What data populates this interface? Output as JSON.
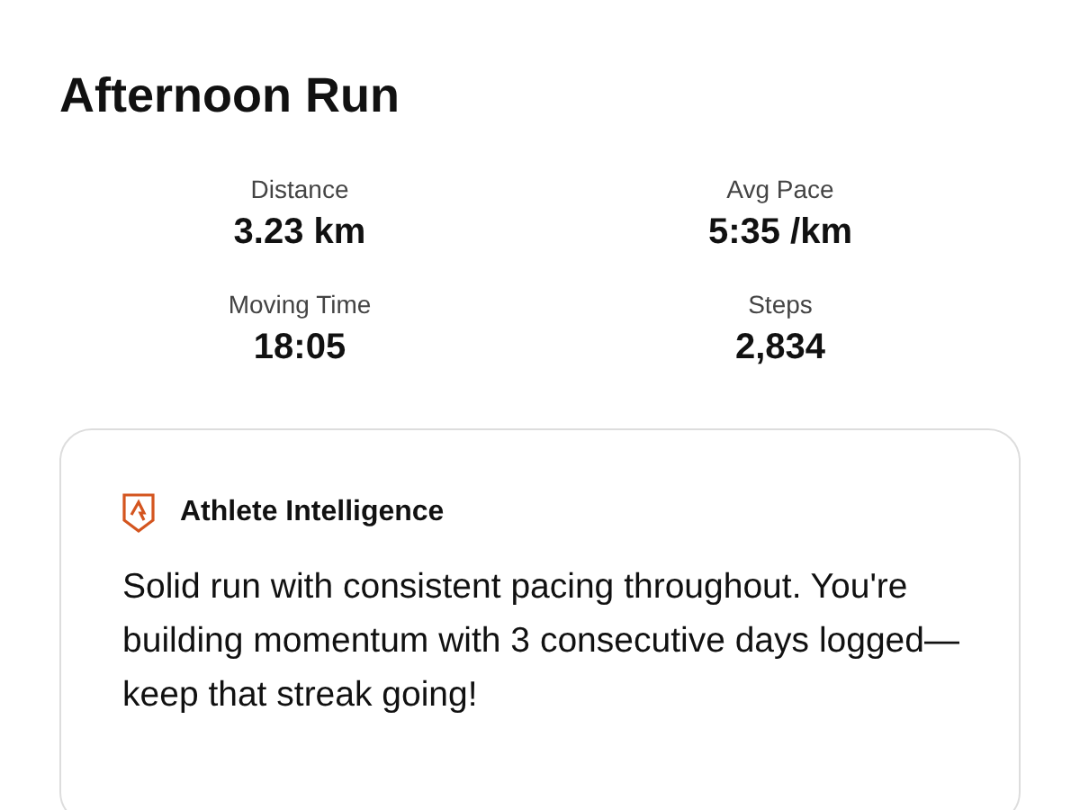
{
  "title": "Afternoon Run",
  "stats": [
    {
      "label": "Distance",
      "value": "3.23 km"
    },
    {
      "label": "Avg Pace",
      "value": "5:35 /km"
    },
    {
      "label": "Moving Time",
      "value": "18:05"
    },
    {
      "label": "Steps",
      "value": "2,834"
    }
  ],
  "insight_card": {
    "heading": "Athlete Intelligence",
    "body": "Solid run with consistent pacing throughout. You're building momentum with 3 consecutive days logged—keep that streak going!"
  }
}
